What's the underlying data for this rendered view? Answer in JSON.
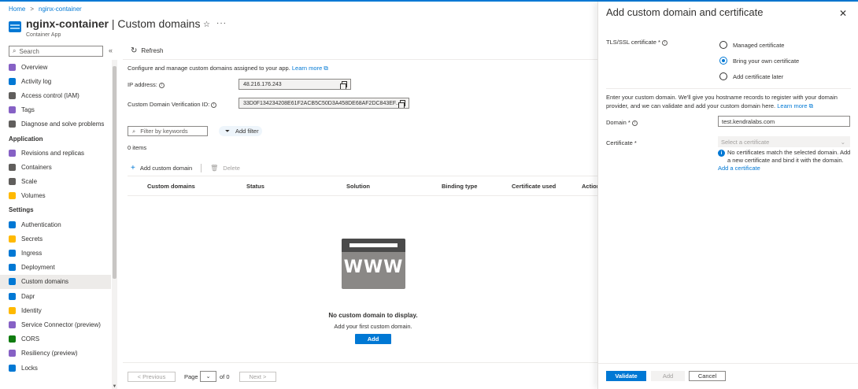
{
  "breadcrumb": {
    "home": "Home",
    "resource": "nginx-container",
    "separator": ">"
  },
  "header": {
    "title_bold": "nginx-container",
    "title_rest": " | Custom domains",
    "subtitle": "Container App",
    "star": "☆",
    "more": "···"
  },
  "sidebar": {
    "search_placeholder": "Search",
    "collapse": "«",
    "items": [
      {
        "label": "Overview",
        "color": "#8661c5"
      },
      {
        "label": "Activity log",
        "color": "#0078d4"
      },
      {
        "label": "Access control (IAM)",
        "color": "#605e5c"
      },
      {
        "label": "Tags",
        "color": "#8661c5"
      },
      {
        "label": "Diagnose and solve problems",
        "color": "#605e5c"
      }
    ],
    "section_application": "Application",
    "app_items": [
      {
        "label": "Revisions and replicas",
        "color": "#8661c5"
      },
      {
        "label": "Containers",
        "color": "#605e5c"
      },
      {
        "label": "Scale",
        "color": "#605e5c"
      },
      {
        "label": "Volumes",
        "color": "#ffb900"
      }
    ],
    "section_settings": "Settings",
    "settings_items": [
      {
        "label": "Authentication",
        "color": "#0078d4"
      },
      {
        "label": "Secrets",
        "color": "#ffb900"
      },
      {
        "label": "Ingress",
        "color": "#0078d4"
      },
      {
        "label": "Deployment",
        "color": "#0078d4"
      },
      {
        "label": "Custom domains",
        "color": "#0078d4",
        "active": true
      },
      {
        "label": "Dapr",
        "color": "#0078d4"
      },
      {
        "label": "Identity",
        "color": "#ffb900"
      },
      {
        "label": "Service Connector (preview)",
        "color": "#8661c5"
      },
      {
        "label": "CORS",
        "color": "#107c10"
      },
      {
        "label": "Resiliency (preview)",
        "color": "#8661c5"
      },
      {
        "label": "Locks",
        "color": "#0078d4"
      }
    ]
  },
  "toolbar": {
    "refresh": "Refresh"
  },
  "main": {
    "description": "Configure and manage custom domains assigned to your app.",
    "learn_more": "Learn more ⧉",
    "ip_label": "IP address:",
    "ip_value": "48.216.176.243",
    "verification_label": "Custom Domain Verification ID:",
    "verification_value": "33D0F134234208E61F2ACB5C50D3A458DE68AF2DC843EF...",
    "filter_placeholder": "Filter by keywords",
    "add_filter": "Add filter",
    "items_count": "0 items",
    "add_custom_domain": "Add custom domain",
    "delete": "Delete",
    "columns": [
      "Custom domains",
      "Status",
      "Solution",
      "Binding type",
      "Certificate used",
      "Actions"
    ],
    "empty_icon_text": "WWW",
    "empty_title": "No custom domain to display.",
    "empty_subtitle": "Add your first custom domain.",
    "empty_add": "Add"
  },
  "pager": {
    "previous": "< Previous",
    "page_label": "Page",
    "page_value": "",
    "of_label": "of 0",
    "next": "Next >"
  },
  "panel": {
    "title": "Add custom domain and certificate",
    "close": "✕",
    "tls_label": "TLS/SSL certificate *",
    "options": [
      {
        "label": "Managed certificate",
        "checked": false
      },
      {
        "label": "Bring your own certificate",
        "checked": true
      },
      {
        "label": "Add certificate later",
        "checked": false
      }
    ],
    "description": "Enter your custom domain. We'll give you hostname records to register with your domain provider, and we can validate and add your custom domain here.",
    "learn_more": "Learn more ⧉",
    "domain_label": "Domain *",
    "domain_value": "test.kendralabs.com",
    "certificate_label": "Certificate *",
    "certificate_placeholder": "Select a certificate",
    "info_text": "No certificates match the selected domain. Add a new certificate and bind it with the domain.",
    "add_certificate_link": "Add a certificate",
    "validate": "Validate",
    "add": "Add",
    "cancel": "Cancel"
  },
  "colors": {
    "accent": "#0078d4",
    "active_bg": "#edebe9"
  }
}
